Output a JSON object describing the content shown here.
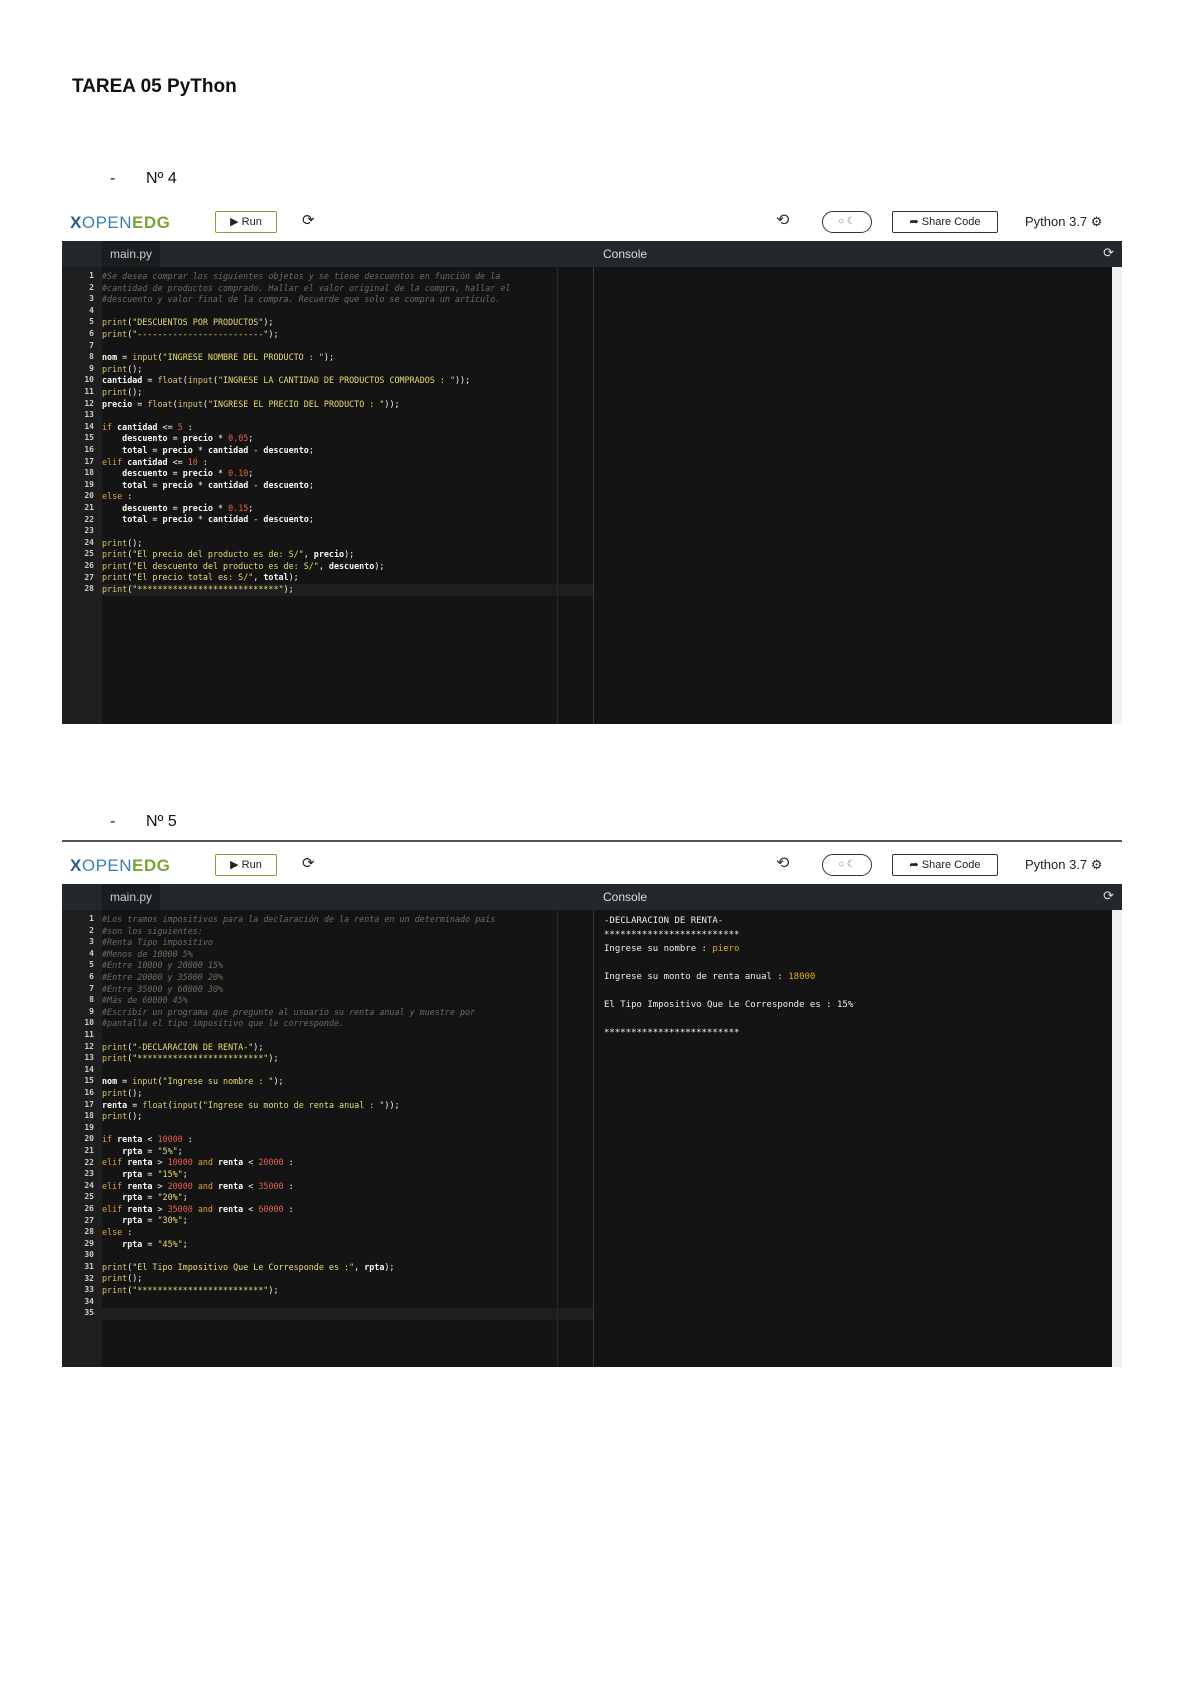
{
  "document_title": "TAREA 05 PyThon",
  "sections": [
    {
      "dash": "-",
      "label": "Nº 4"
    },
    {
      "dash": "-",
      "label": "Nº 5"
    }
  ],
  "ide": {
    "logo": {
      "x": "X",
      "open": "OPEN",
      "edg": "EDG"
    },
    "run_label": "▶ Run",
    "reload_icon": "⟳",
    "rotate_icon": "⟲",
    "toggle_label": "○ ☾",
    "share_label": "➦ Share Code",
    "language": "Python 3.7",
    "gear_icon": "⚙",
    "file_tab": "main.py",
    "console_label": "Console",
    "console_refresh_icon": "⟳"
  },
  "editors": [
    {
      "active_line": 28,
      "code": [
        [
          [
            "c",
            "#Se desea comprar los siguientes objetos y se tiene descuentos en función de la"
          ]
        ],
        [
          [
            "c",
            "#cantidad de productos comprado. Hallar el valor original de la compra, hallar el"
          ]
        ],
        [
          [
            "c",
            "#descuento y valor final de la compra. Recuerde que solo se compra un artículo."
          ]
        ],
        [],
        [
          [
            "f",
            "print"
          ],
          [
            "o",
            "("
          ],
          [
            "s",
            "\"DESCUENTOS POR PRODUCTOS\""
          ],
          [
            "o",
            ");"
          ]
        ],
        [
          [
            "f",
            "print"
          ],
          [
            "o",
            "("
          ],
          [
            "s",
            "\"-------------------------\""
          ],
          [
            "o",
            ");"
          ]
        ],
        [],
        [
          [
            "v",
            "nom"
          ],
          [
            "o",
            " = "
          ],
          [
            "f",
            "input"
          ],
          [
            "o",
            "("
          ],
          [
            "s",
            "\"INGRESE NOMBRE DEL PRODUCTO : \""
          ],
          [
            "o",
            ");"
          ]
        ],
        [
          [
            "f",
            "print"
          ],
          [
            "o",
            "();"
          ]
        ],
        [
          [
            "v",
            "cantidad"
          ],
          [
            "o",
            " = "
          ],
          [
            "f",
            "float"
          ],
          [
            "o",
            "("
          ],
          [
            "f",
            "input"
          ],
          [
            "o",
            "("
          ],
          [
            "s",
            "\"INGRESE LA CANTIDAD DE PRODUCTOS COMPRADOS : \""
          ],
          [
            "o",
            "));"
          ]
        ],
        [
          [
            "f",
            "print"
          ],
          [
            "o",
            "();"
          ]
        ],
        [
          [
            "v",
            "precio"
          ],
          [
            "o",
            " = "
          ],
          [
            "f",
            "float"
          ],
          [
            "o",
            "("
          ],
          [
            "f",
            "input"
          ],
          [
            "o",
            "("
          ],
          [
            "s",
            "\"INGRESE EL PRECIO DEL PRODUCTO : \""
          ],
          [
            "o",
            "));"
          ]
        ],
        [],
        [
          [
            "k",
            "if "
          ],
          [
            "v",
            "cantidad"
          ],
          [
            "o",
            " <= "
          ],
          [
            "n",
            "5"
          ],
          [
            "o",
            " :"
          ]
        ],
        [
          [
            "o",
            "    "
          ],
          [
            "v",
            "descuento"
          ],
          [
            "o",
            " = "
          ],
          [
            "v",
            "precio"
          ],
          [
            "o",
            " * "
          ],
          [
            "n",
            "0.05"
          ],
          [
            "o",
            ";"
          ]
        ],
        [
          [
            "o",
            "    "
          ],
          [
            "v",
            "total"
          ],
          [
            "o",
            " = "
          ],
          [
            "v",
            "precio"
          ],
          [
            "o",
            " * "
          ],
          [
            "v",
            "cantidad"
          ],
          [
            "o",
            " - "
          ],
          [
            "v",
            "descuento"
          ],
          [
            "o",
            ";"
          ]
        ],
        [
          [
            "k",
            "elif "
          ],
          [
            "v",
            "cantidad"
          ],
          [
            "o",
            " <= "
          ],
          [
            "n",
            "10"
          ],
          [
            "o",
            " :"
          ]
        ],
        [
          [
            "o",
            "    "
          ],
          [
            "v",
            "descuento"
          ],
          [
            "o",
            " = "
          ],
          [
            "v",
            "precio"
          ],
          [
            "o",
            " * "
          ],
          [
            "n",
            "0.10"
          ],
          [
            "o",
            ";"
          ]
        ],
        [
          [
            "o",
            "    "
          ],
          [
            "v",
            "total"
          ],
          [
            "o",
            " = "
          ],
          [
            "v",
            "precio"
          ],
          [
            "o",
            " * "
          ],
          [
            "v",
            "cantidad"
          ],
          [
            "o",
            " - "
          ],
          [
            "v",
            "descuento"
          ],
          [
            "o",
            ";"
          ]
        ],
        [
          [
            "k",
            "else"
          ],
          [
            "o",
            " :"
          ]
        ],
        [
          [
            "o",
            "    "
          ],
          [
            "v",
            "descuento"
          ],
          [
            "o",
            " = "
          ],
          [
            "v",
            "precio"
          ],
          [
            "o",
            " * "
          ],
          [
            "n",
            "0.15"
          ],
          [
            "o",
            ";"
          ]
        ],
        [
          [
            "o",
            "    "
          ],
          [
            "v",
            "total"
          ],
          [
            "o",
            " = "
          ],
          [
            "v",
            "precio"
          ],
          [
            "o",
            " * "
          ],
          [
            "v",
            "cantidad"
          ],
          [
            "o",
            " - "
          ],
          [
            "v",
            "descuento"
          ],
          [
            "o",
            ";"
          ]
        ],
        [],
        [
          [
            "f",
            "print"
          ],
          [
            "o",
            "();"
          ]
        ],
        [
          [
            "f",
            "print"
          ],
          [
            "o",
            "("
          ],
          [
            "s",
            "\"El precio del producto es de: S/\""
          ],
          [
            "o",
            ", "
          ],
          [
            "v",
            "precio"
          ],
          [
            "o",
            ");"
          ]
        ],
        [
          [
            "f",
            "print"
          ],
          [
            "o",
            "("
          ],
          [
            "s",
            "\"El descuento del producto es de: S/\""
          ],
          [
            "o",
            ", "
          ],
          [
            "v",
            "descuento"
          ],
          [
            "o",
            ");"
          ]
        ],
        [
          [
            "f",
            "print"
          ],
          [
            "o",
            "("
          ],
          [
            "s",
            "\"El precio total es: S/\""
          ],
          [
            "o",
            ", "
          ],
          [
            "v",
            "total"
          ],
          [
            "o",
            ");"
          ]
        ],
        [
          [
            "f",
            "print"
          ],
          [
            "o",
            "("
          ],
          [
            "s",
            "\"****************************\""
          ],
          [
            "o",
            ");"
          ]
        ]
      ],
      "console": []
    },
    {
      "active_line": 35,
      "code": [
        [
          [
            "c",
            "#Los tramos impositivos para la declaración de la renta en un determinado país"
          ]
        ],
        [
          [
            "c",
            "#son los siguientes:"
          ]
        ],
        [
          [
            "c",
            "#Renta Tipo impositivo"
          ]
        ],
        [
          [
            "c",
            "#Menos de 10000 5%"
          ]
        ],
        [
          [
            "c",
            "#Entre 10000 y 20000 15%"
          ]
        ],
        [
          [
            "c",
            "#Entre 20000 y 35000 20%"
          ]
        ],
        [
          [
            "c",
            "#Entre 35000 y 60000 30%"
          ]
        ],
        [
          [
            "c",
            "#Más de 60000 45%"
          ]
        ],
        [
          [
            "c",
            "#Escribir un programa que pregunte al usuario su renta anual y muestre por"
          ]
        ],
        [
          [
            "c",
            "#pantalla el tipo impositivo que le corresponde."
          ]
        ],
        [],
        [
          [
            "f",
            "print"
          ],
          [
            "o",
            "("
          ],
          [
            "s",
            "\"-DECLARACION DE RENTA-\""
          ],
          [
            "o",
            ");"
          ]
        ],
        [
          [
            "f",
            "print"
          ],
          [
            "o",
            "("
          ],
          [
            "s",
            "\"*************************\""
          ],
          [
            "o",
            ");"
          ]
        ],
        [],
        [
          [
            "v",
            "nom"
          ],
          [
            "o",
            " = "
          ],
          [
            "f",
            "input"
          ],
          [
            "o",
            "("
          ],
          [
            "s",
            "\"Ingrese su nombre : \""
          ],
          [
            "o",
            ");"
          ]
        ],
        [
          [
            "f",
            "print"
          ],
          [
            "o",
            "();"
          ]
        ],
        [
          [
            "v",
            "renta"
          ],
          [
            "o",
            " = "
          ],
          [
            "f",
            "float"
          ],
          [
            "o",
            "("
          ],
          [
            "f",
            "input"
          ],
          [
            "o",
            "("
          ],
          [
            "s",
            "\"Ingrese su monto de renta anual : \""
          ],
          [
            "o",
            "));"
          ]
        ],
        [
          [
            "f",
            "print"
          ],
          [
            "o",
            "();"
          ]
        ],
        [],
        [
          [
            "k",
            "if "
          ],
          [
            "v",
            "renta"
          ],
          [
            "o",
            " < "
          ],
          [
            "n",
            "10000"
          ],
          [
            "o",
            " :"
          ]
        ],
        [
          [
            "o",
            "    "
          ],
          [
            "v",
            "rpta"
          ],
          [
            "o",
            " = "
          ],
          [
            "s",
            "\"5%\""
          ],
          [
            "o",
            ";"
          ]
        ],
        [
          [
            "k",
            "elif "
          ],
          [
            "v",
            "renta"
          ],
          [
            "o",
            " > "
          ],
          [
            "n",
            "10000"
          ],
          [
            "k",
            " and "
          ],
          [
            "v",
            "renta"
          ],
          [
            "o",
            " < "
          ],
          [
            "n",
            "20000"
          ],
          [
            "o",
            " :"
          ]
        ],
        [
          [
            "o",
            "    "
          ],
          [
            "v",
            "rpta"
          ],
          [
            "o",
            " = "
          ],
          [
            "s",
            "\"15%\""
          ],
          [
            "o",
            ";"
          ]
        ],
        [
          [
            "k",
            "elif "
          ],
          [
            "v",
            "renta"
          ],
          [
            "o",
            " > "
          ],
          [
            "n",
            "20000"
          ],
          [
            "k",
            " and "
          ],
          [
            "v",
            "renta"
          ],
          [
            "o",
            " < "
          ],
          [
            "n",
            "35000"
          ],
          [
            "o",
            " :"
          ]
        ],
        [
          [
            "o",
            "    "
          ],
          [
            "v",
            "rpta"
          ],
          [
            "o",
            " = "
          ],
          [
            "s",
            "\"20%\""
          ],
          [
            "o",
            ";"
          ]
        ],
        [
          [
            "k",
            "elif "
          ],
          [
            "v",
            "renta"
          ],
          [
            "o",
            " > "
          ],
          [
            "n",
            "35000"
          ],
          [
            "k",
            " and "
          ],
          [
            "v",
            "renta"
          ],
          [
            "o",
            " < "
          ],
          [
            "n",
            "60000"
          ],
          [
            "o",
            " :"
          ]
        ],
        [
          [
            "o",
            "    "
          ],
          [
            "v",
            "rpta"
          ],
          [
            "o",
            " = "
          ],
          [
            "s",
            "\"30%\""
          ],
          [
            "o",
            ";"
          ]
        ],
        [
          [
            "k",
            "else"
          ],
          [
            "o",
            " :"
          ]
        ],
        [
          [
            "o",
            "    "
          ],
          [
            "v",
            "rpta"
          ],
          [
            "o",
            " = "
          ],
          [
            "s",
            "\"45%\""
          ],
          [
            "o",
            ";"
          ]
        ],
        [],
        [
          [
            "f",
            "print"
          ],
          [
            "o",
            "("
          ],
          [
            "s",
            "\"El Tipo Impositivo Que Le Corresponde es :\""
          ],
          [
            "o",
            ", "
          ],
          [
            "v",
            "rpta"
          ],
          [
            "o",
            ");"
          ]
        ],
        [
          [
            "f",
            "print"
          ],
          [
            "o",
            "();"
          ]
        ],
        [
          [
            "f",
            "print"
          ],
          [
            "o",
            "("
          ],
          [
            "s",
            "\"*************************\""
          ],
          [
            "o",
            ");"
          ]
        ],
        [],
        []
      ],
      "console": [
        {
          "text": "-DECLARACION DE RENTA-"
        },
        {
          "text": "*************************"
        },
        {
          "text": "Ingrese su nombre : ",
          "input": "piero"
        },
        {
          "text": ""
        },
        {
          "text": "Ingrese su monto de renta anual : ",
          "input": "18000"
        },
        {
          "text": ""
        },
        {
          "text": "El Tipo Impositivo Que Le Corresponde es : 15%"
        },
        {
          "text": ""
        },
        {
          "text": "*************************"
        }
      ]
    }
  ]
}
